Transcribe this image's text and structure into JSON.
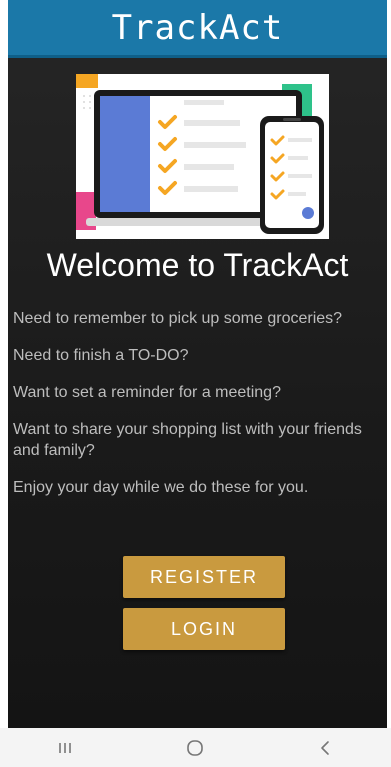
{
  "app_bar": {
    "title": "TrackAct"
  },
  "hero_image": {
    "icon": "devices-checklist-illustration"
  },
  "welcome": {
    "heading": "Welcome to TrackAct"
  },
  "intro_lines": [
    "Need to remember to pick up some groceries?",
    "Need to finish a TO-DO?",
    "Want to set a reminder for a meeting?",
    "Want to share your shopping list with your friends and family?",
    "Enjoy your day while we do these for you."
  ],
  "buttons": {
    "register_label": "REGISTER",
    "login_label": "LOGIN"
  },
  "nav_bar": {
    "recents_icon": "recents-icon",
    "home_icon": "home-icon",
    "back_icon": "back-icon"
  },
  "colors": {
    "app_bar": "#1b78a8",
    "background": "#1f1f1f",
    "button": "#c99a3f",
    "text": "#bdbdbd",
    "heading": "#ffffff",
    "check": "#f5a623",
    "panel_blue": "#5b7bd5",
    "accent_green": "#2ec28a",
    "accent_pink": "#e8478b"
  }
}
